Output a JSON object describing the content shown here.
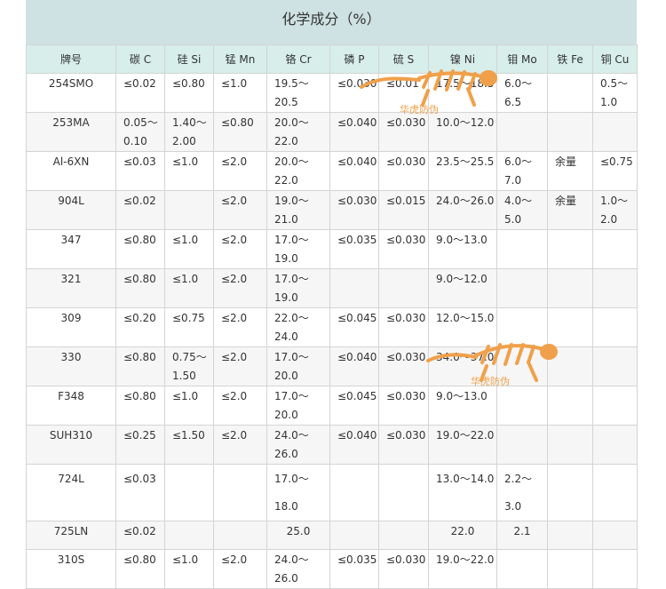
{
  "title": "化学成分（%）",
  "headers": [
    "牌号",
    "碳 C",
    "硅 Si",
    "锰 Mn",
    "铬 Cr",
    "磷 P",
    "硫 S",
    "镍 Ni",
    "钼 Mo",
    "铁 Fe",
    "铜 Cu"
  ],
  "rows": [
    [
      "254SMO",
      "≤0.02",
      "≤0.80",
      "≤1.0",
      "19.5～\n20.5",
      "≤0.030",
      "≤0.01",
      "17.5～18.5",
      "6.0～\n6.5",
      "",
      "0.5～\n1.0"
    ],
    [
      "253MA",
      "0.05～\n0.10",
      "1.40～\n2.00",
      "≤0.80",
      "20.0～\n22.0",
      "≤0.040",
      "≤0.030",
      "10.0～12.0",
      "",
      "",
      ""
    ],
    [
      "Al-6XN",
      "≤0.03",
      "≤1.0",
      "≤2.0",
      "20.0～\n22.0",
      "≤0.040",
      "≤0.030",
      "23.5～25.5",
      "6.0～\n7.0",
      "余量",
      "≤0.75"
    ],
    [
      "904L",
      "≤0.02",
      "",
      "≤2.0",
      "19.0～\n21.0",
      "≤0.030",
      "≤0.015",
      "24.0～26.0",
      "4.0～\n5.0",
      "余量",
      "1.0～\n2.0"
    ],
    [
      "347",
      "≤0.80",
      "≤1.0",
      "≤2.0",
      "17.0～\n19.0",
      "≤0.035",
      "≤0.030",
      "9.0～13.0",
      "",
      "",
      ""
    ],
    [
      "321",
      "≤0.80",
      "≤1.0",
      "≤2.0",
      "17.0～\n19.0",
      "",
      "",
      "9.0～12.0",
      "",
      "",
      ""
    ],
    [
      "309",
      "≤0.20",
      "≤0.75",
      "≤2.0",
      "22.0～\n24.0",
      "≤0.045",
      "≤0.030",
      "12.0～15.0",
      "",
      "",
      ""
    ],
    [
      "330",
      "≤0.80",
      "0.75～\n1.50",
      "≤2.0",
      "17.0～\n20.0",
      "≤0.040",
      "≤0.030",
      "34.0～37.0",
      "",
      "",
      ""
    ],
    [
      "F348",
      "≤0.80",
      "≤1.0",
      "≤2.0",
      "17.0～\n20.0",
      "≤0.045",
      "≤0.030",
      "9.0～13.0",
      "",
      "",
      ""
    ],
    [
      "SUH310",
      "≤0.25",
      "≤1.50",
      "≤2.0",
      "24.0～\n26.0",
      "≤0.040",
      "≤0.030",
      "19.0～22.0",
      "",
      "",
      ""
    ],
    [
      "724L",
      "≤0.03",
      "",
      "",
      "17.0～\n18.0",
      "",
      "",
      "13.0～14.0",
      "2.2～\n3.0",
      "",
      ""
    ],
    [
      "725LN",
      "≤0.02",
      "",
      "",
      "25.0",
      "",
      "",
      "22.0",
      "2.1",
      "",
      ""
    ],
    [
      "310S",
      "≤0.80",
      "≤1.0",
      "≤2.0",
      "24.0～\n26.0",
      "≤0.035",
      "≤0.030",
      "19.0～22.0",
      "",
      "",
      ""
    ]
  ],
  "watermark": {
    "text": "华虎防伪",
    "color": "#f0a04a"
  }
}
